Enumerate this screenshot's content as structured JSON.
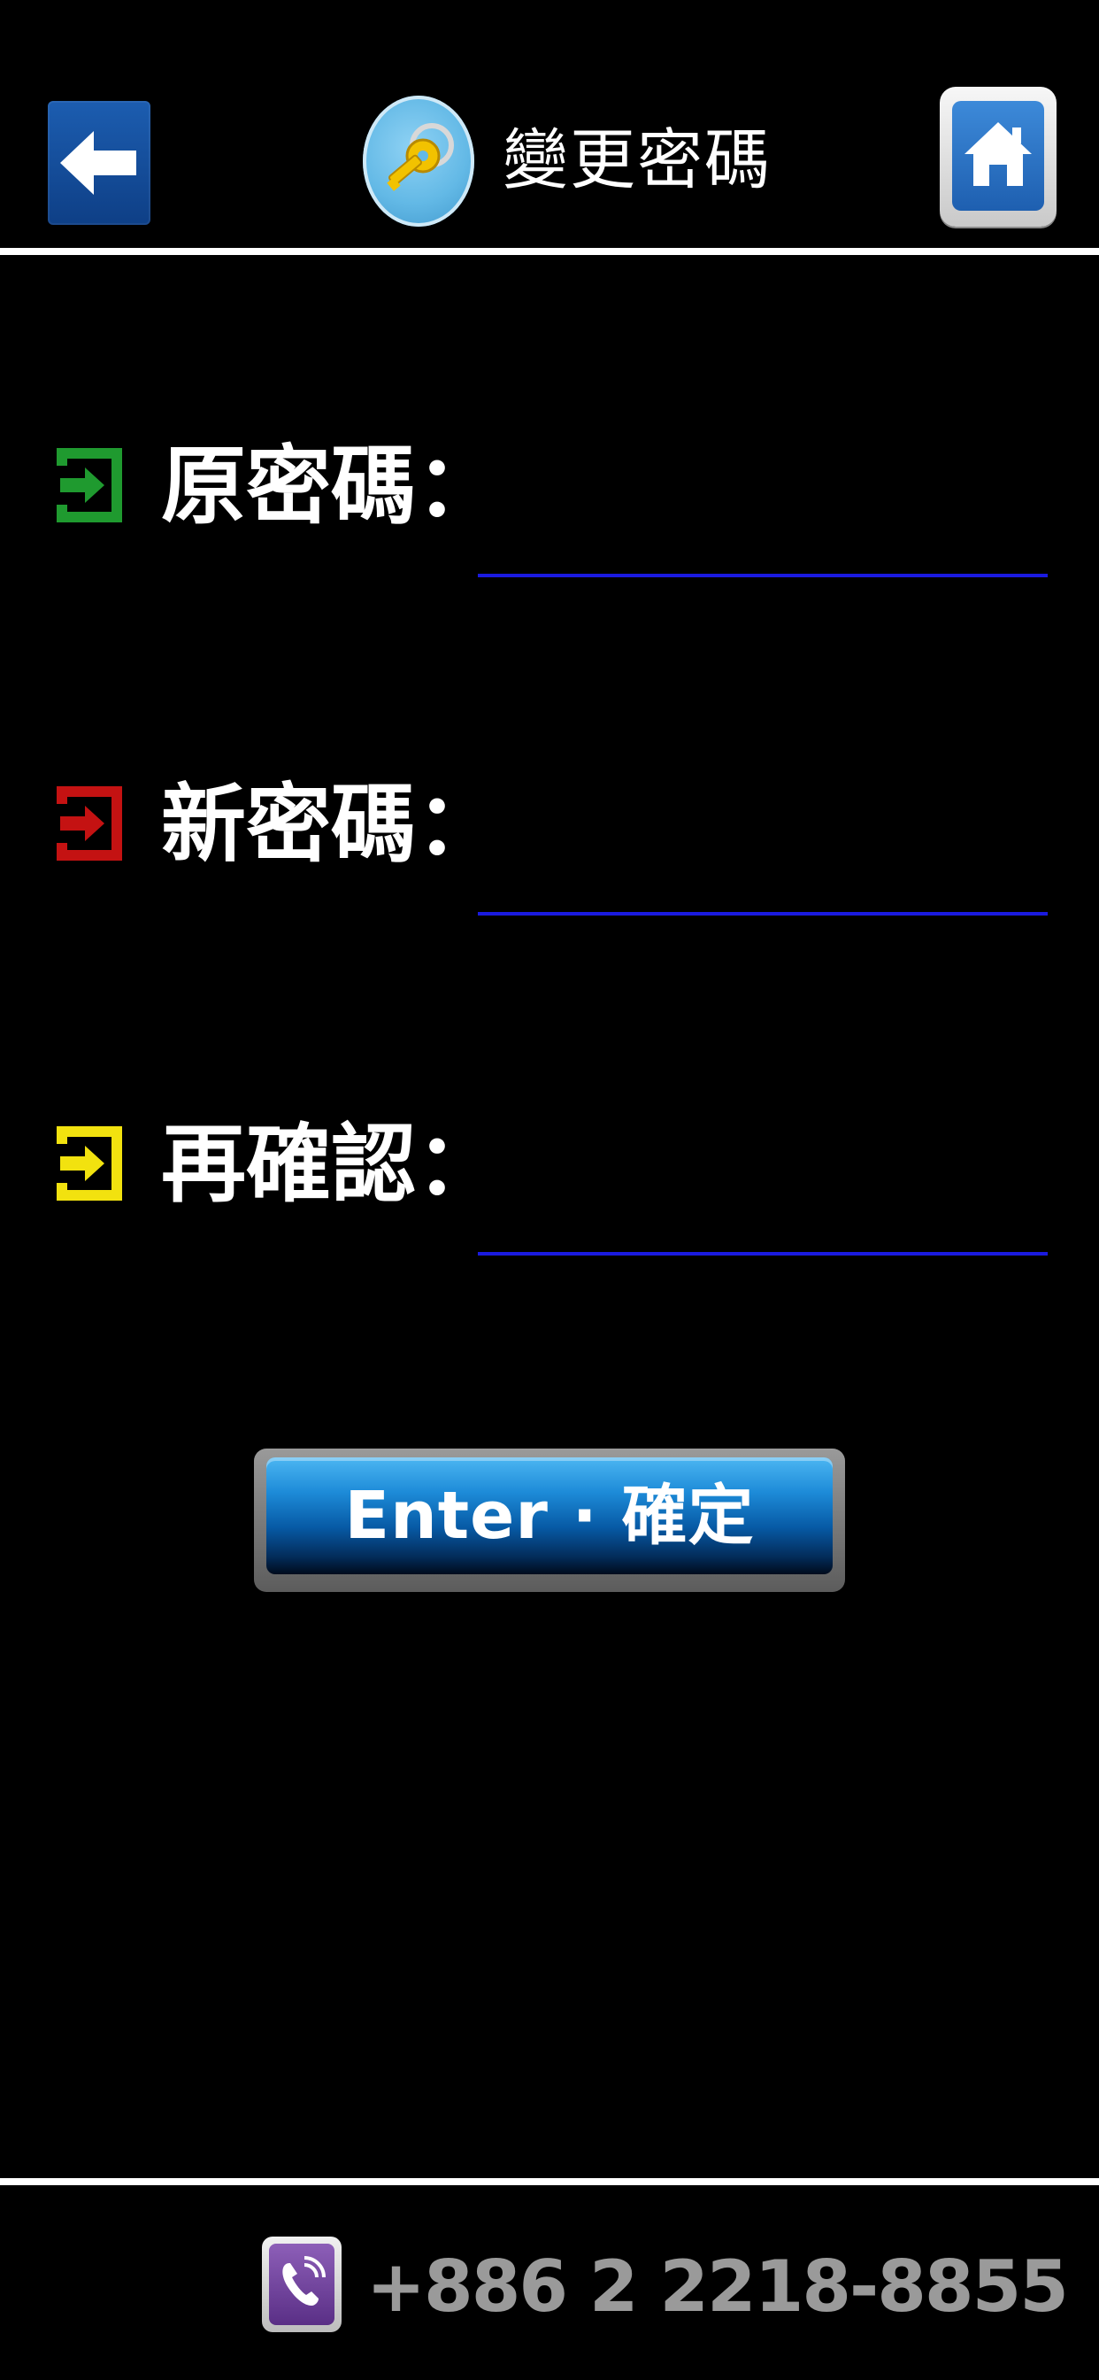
{
  "header": {
    "back_icon": "arrow-left-icon",
    "title_icon": "key-icon",
    "title": "變更密碼",
    "home_icon": "home-icon"
  },
  "form": {
    "rows": [
      {
        "label": "原密碼：",
        "icon": "enter-arrow-icon",
        "icon_color": "#1f9a2f",
        "value": ""
      },
      {
        "label": "新密碼：",
        "icon": "enter-arrow-icon",
        "icon_color": "#c41212",
        "value": ""
      },
      {
        "label": "再確認：",
        "icon": "enter-arrow-icon",
        "icon_color": "#f2e20f",
        "value": ""
      }
    ],
    "underline_color": "#1a1ae0"
  },
  "enter_button": {
    "label": "Enter · 確定"
  },
  "footer": {
    "phone_icon": "phone-icon",
    "phone_number": "+886 2 2218-8855"
  },
  "colors": {
    "background": "#000000",
    "accent_blue": "#1d8bd8",
    "back_button": "#1c5db0",
    "footer_text": "#9a9a9a"
  }
}
